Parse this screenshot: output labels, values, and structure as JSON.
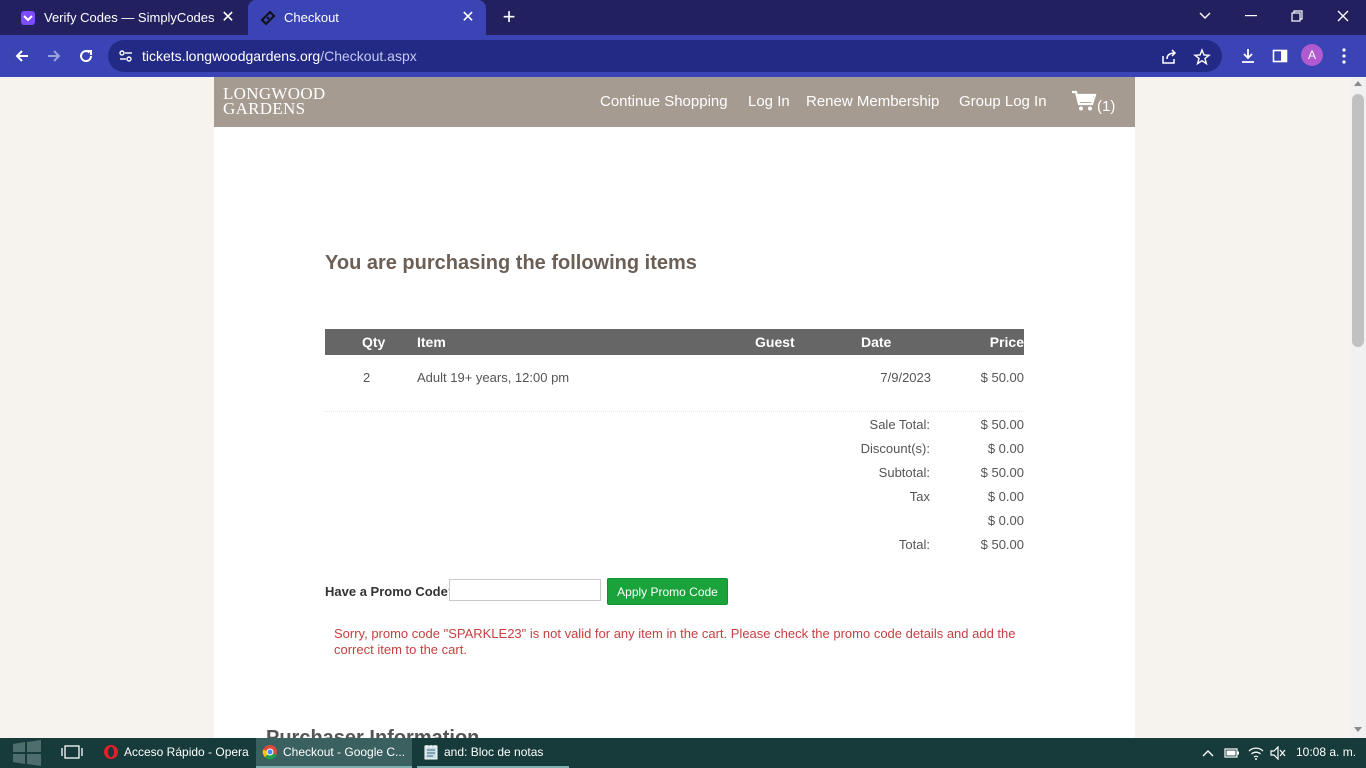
{
  "browser": {
    "tabs": [
      {
        "title": "Verify Codes — SimplyCodes",
        "icon": "simplycodes-icon"
      },
      {
        "title": "Checkout",
        "icon": "ticket-icon"
      }
    ],
    "new_tab": "+",
    "url_host": "tickets.longwoodgardens.org",
    "url_path": "/Checkout.aspx",
    "profile_initial": "A"
  },
  "site": {
    "logo_line1": "LONGWOOD",
    "logo_line2": "GARDENS",
    "nav": {
      "continue_shopping": "Continue Shopping",
      "log_in": "Log In",
      "renew_membership": "Renew Membership",
      "group_log_in": "Group Log In",
      "cart_count": "(1)"
    }
  },
  "checkout": {
    "heading": "You are purchasing the following items",
    "columns": {
      "qty": "Qty",
      "item": "Item",
      "guest": "Guest",
      "date": "Date",
      "price": "Price"
    },
    "items": [
      {
        "qty": "2",
        "item": "Adult 19+ years, 12:00 pm",
        "guest": "",
        "date": "7/9/2023",
        "price": "$ 50.00"
      }
    ],
    "totals": [
      {
        "label": "Sale Total:",
        "value": "$ 50.00"
      },
      {
        "label": "Discount(s):",
        "value": "$ 0.00"
      },
      {
        "label": "Subtotal:",
        "value": "$ 50.00"
      },
      {
        "label": "Tax",
        "value": "$ 0.00"
      },
      {
        "label": "",
        "value": "$ 0.00"
      },
      {
        "label": "Total:",
        "value": "$ 50.00"
      }
    ],
    "promo_label": "Have a Promo Code?",
    "promo_value": "",
    "promo_button": "Apply Promo Code",
    "promo_error": "Sorry, promo code \"SPARKLE23\" is not valid for any item in the cart. Please check the promo code details and add the correct item to the cart.",
    "next_section_heading": "Purchaser Information"
  },
  "taskbar": {
    "items": [
      {
        "label": "Acceso Rápido - Opera",
        "icon": "opera-icon"
      },
      {
        "label": "Checkout - Google C...",
        "icon": "chrome-icon"
      },
      {
        "label": "and: Bloc de notas",
        "icon": "notepad-icon"
      }
    ],
    "clock": "10:08 a. m."
  },
  "colors": {
    "tab_strip": "#232060",
    "toolbar": "#3a44b4",
    "site_header": "#a69b91",
    "table_header": "#666666",
    "apply_button": "#1aa33b",
    "error_text": "#c64040",
    "taskbar": "#173a3a"
  }
}
